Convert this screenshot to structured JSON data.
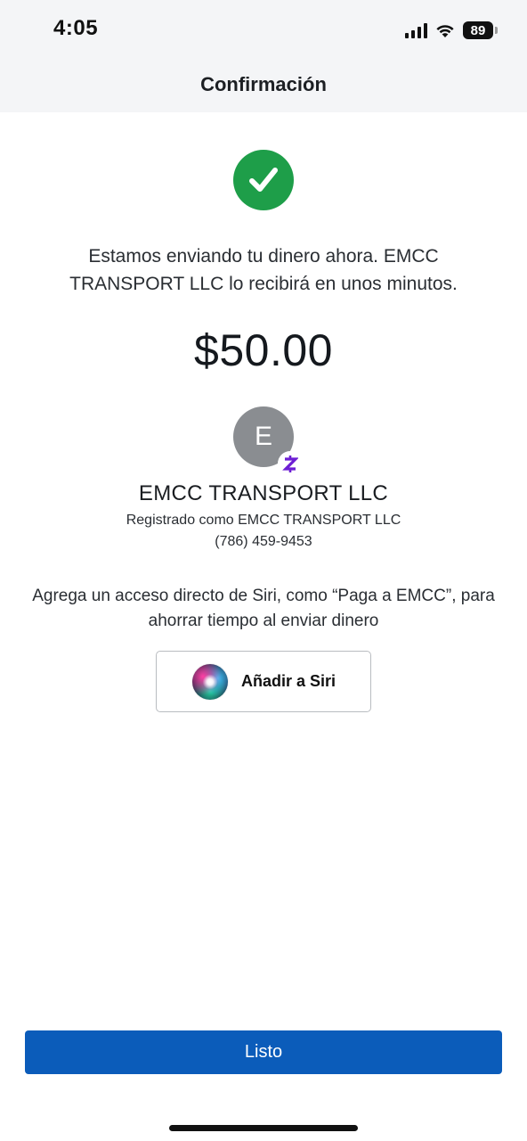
{
  "status_bar": {
    "time": "4:05",
    "battery_level": "89"
  },
  "header": {
    "title": "Confirmación"
  },
  "confirmation": {
    "message": "Estamos enviando tu dinero ahora. EMCC TRANSPORT LLC lo recibirá en unos minutos.",
    "amount": "$50.00"
  },
  "recipient": {
    "avatar_initial": "E",
    "name": "EMCC TRANSPORT LLC",
    "registered_as": "Registrado como EMCC TRANSPORT LLC",
    "phone": "(786) 459-9453"
  },
  "siri": {
    "prompt": "Agrega un acceso directo de Siri, como “Paga a EMCC”, para ahorrar tiempo al enviar dinero",
    "button_label": "Añadir a Siri"
  },
  "footer": {
    "done_label": "Listo"
  },
  "colors": {
    "success_green": "#1e9e49",
    "primary_blue": "#0b5cba",
    "zelle_purple": "#6d1ed4",
    "avatar_gray": "#8a8d91"
  },
  "icons": [
    "signal-icon",
    "wifi-icon",
    "battery-icon",
    "checkmark-icon",
    "zelle-icon",
    "siri-icon"
  ]
}
